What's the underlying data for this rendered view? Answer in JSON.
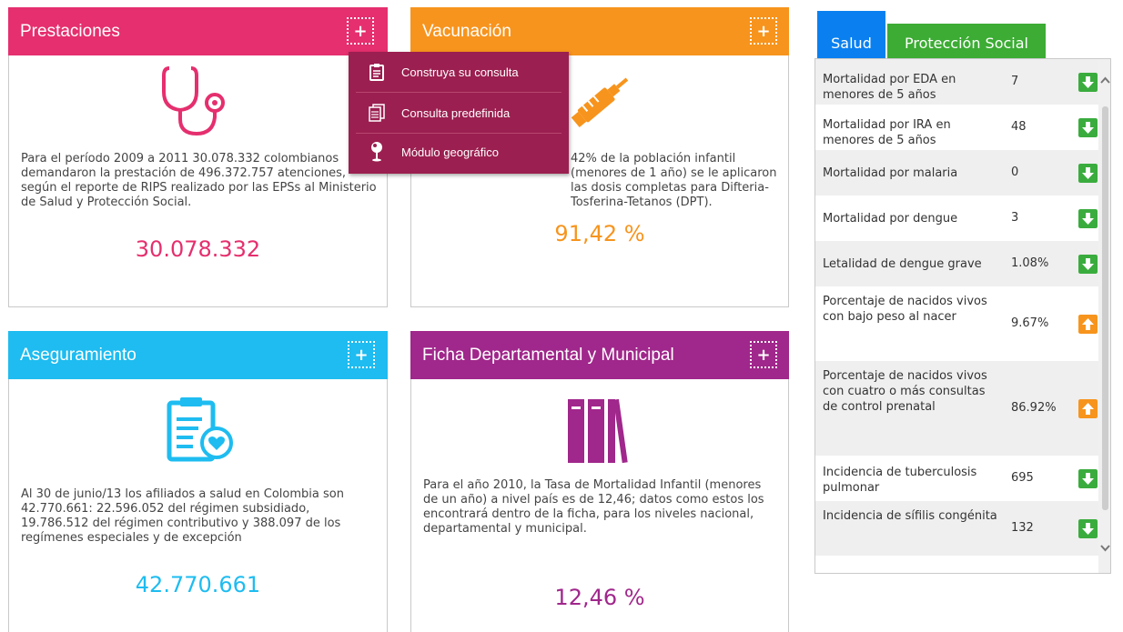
{
  "colors": {
    "prestaciones": "#e52f6e",
    "vacunacion": "#f7941d",
    "aseguramiento": "#1ebcf0",
    "ficha": "#a0278b",
    "salud_tab": "#0a80f0",
    "proteccion_tab": "#3cac34",
    "row_alt": "#efefef",
    "arrow_down": "#3aac3e",
    "arrow_up": "#f7941d"
  },
  "cards": {
    "prestaciones": {
      "title": "Prestaciones",
      "plus": "+",
      "icon": "stethoscope-icon",
      "desc": "Para el período 2009 a 2011 30.078.332 colombianos demandaron la prestación de 496.372.757 atenciones, según el reporte de RIPS realizado por las EPSs al Ministerio de Salud y Protección Social.",
      "value": "30.078.332"
    },
    "vacunacion": {
      "title": "Vacunación",
      "plus": "+",
      "icon": "syringe-icon",
      "desc": "42% de la población infantil (menores de 1 año) se le aplicaron las dosis completas para Difteria-Tosferina-Tetanos (DPT).",
      "value": "91,42 %"
    },
    "aseguramiento": {
      "title": "Aseguramiento",
      "plus": "+",
      "icon": "clipboard-heart-icon",
      "desc": "Al 30 de junio/13 los afiliados a salud en Colombia son 42.770.661: 22.596.052 del régimen subsidiado, 19.786.512 del régimen contributivo y 388.097 de los regímenes especiales y de excepción",
      "value": "42.770.661"
    },
    "ficha": {
      "title": "Ficha Departamental y Municipal",
      "plus": "+",
      "icon": "books-icon",
      "desc": "Para el año 2010, la Tasa de Mortalidad Infantil (menores de un año) a nivel país es de 12,46; datos como estos los encontrará dentro de la ficha, para los niveles nacional, departamental y municipal.",
      "value": "12,46 %"
    }
  },
  "dropdown": {
    "items": [
      {
        "label": "Construya su consulta",
        "icon": "clipboard-icon"
      },
      {
        "label": "Consulta predefinida",
        "icon": "documents-icon"
      },
      {
        "label": "Módulo geográfico",
        "icon": "map-pin-icon"
      }
    ]
  },
  "tabs": {
    "salud": "Salud",
    "proteccion": "Protección Social"
  },
  "indicators": [
    {
      "label": "Mortalidad por EDA en menores de 5 años",
      "value": "7",
      "trend": "down"
    },
    {
      "label": "Mortalidad por IRA en menores de 5 años",
      "value": "48",
      "trend": "down"
    },
    {
      "label": "Mortalidad por malaria",
      "value": "0",
      "trend": "down"
    },
    {
      "label": "Mortalidad por dengue",
      "value": "3",
      "trend": "down"
    },
    {
      "label": "Letalidad de dengue grave",
      "value": "1.08%",
      "trend": "down"
    },
    {
      "label": "Porcentaje de nacidos vivos con bajo peso al nacer",
      "value": "9.67%",
      "trend": "up"
    },
    {
      "label": "Porcentaje de nacidos vivos con cuatro o más consultas de control prenatal",
      "value": "86.92%",
      "trend": "up"
    },
    {
      "label": "Incidencia de tuberculosis pulmonar",
      "value": "695",
      "trend": "down"
    },
    {
      "label": "Incidencia de sífilis congénita",
      "value": "132",
      "trend": "down"
    }
  ]
}
